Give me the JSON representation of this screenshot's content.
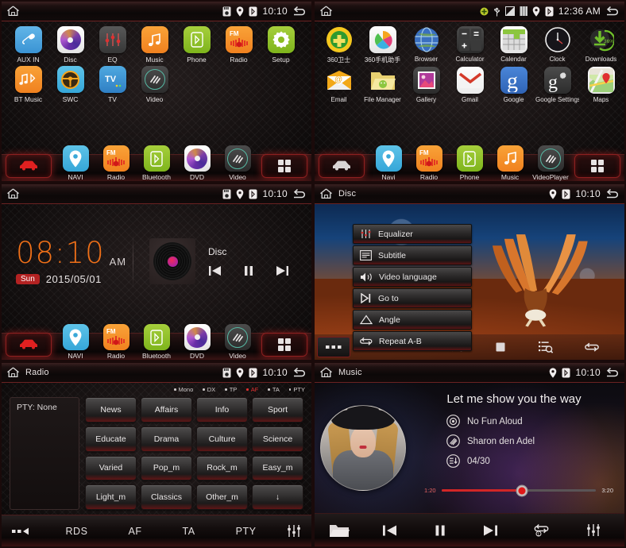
{
  "panels": {
    "home_apps": {
      "status": {
        "title": "",
        "time": "10:10",
        "icons": [
          "sd-card-icon",
          "location-icon",
          "bluetooth-icon"
        ],
        "back": "back-icon"
      },
      "rows": [
        [
          {
            "label": "AUX IN",
            "icon": "aux-plug-icon",
            "style": "g-blue"
          },
          {
            "label": "Disc",
            "icon": "disc-icon",
            "style": "g-white"
          },
          {
            "label": "EQ",
            "icon": "equalizer-icon",
            "style": "g-grey"
          },
          {
            "label": "Music",
            "icon": "music-note-icon",
            "style": "g-orange"
          },
          {
            "label": "Phone",
            "icon": "bluetooth-phone-icon",
            "style": "g-green"
          },
          {
            "label": "Radio",
            "icon": "fm-radio-icon",
            "style": "g-orange"
          },
          {
            "label": "Setup",
            "icon": "gear-icon",
            "style": "g-green"
          }
        ],
        [
          {
            "label": "BT Music",
            "icon": "bt-music-icon",
            "style": "g-orange"
          },
          {
            "label": "SWC",
            "icon": "steering-wheel-icon",
            "style": "g-cyan"
          },
          {
            "label": "TV",
            "icon": "tv-icon",
            "style": "g-tvblue"
          },
          {
            "label": "Video",
            "icon": "video-icon",
            "style": "g-dark"
          }
        ]
      ],
      "dock": {
        "home_button": "car-home-icon",
        "apps_button": "app-drawer-icon",
        "items": [
          {
            "label": "NAVI",
            "icon": "navi-pin-icon",
            "style": "g-cyan"
          },
          {
            "label": "Radio",
            "icon": "fm-radio-icon",
            "style": "g-orange"
          },
          {
            "label": "Bluetooth",
            "icon": "bluetooth-phone-icon",
            "style": "g-green"
          },
          {
            "label": "DVD",
            "icon": "disc-icon",
            "style": "g-white"
          },
          {
            "label": "Video",
            "icon": "video-icon",
            "style": "g-dark"
          }
        ]
      }
    },
    "android_apps": {
      "status": {
        "title": "",
        "time": "12:36 AM",
        "icons": [
          "update-icon",
          "usb-icon",
          "screenshot-icon",
          "sim-icon",
          "location-icon",
          "bluetooth-icon"
        ],
        "back": "back-icon"
      },
      "rows": [
        [
          {
            "label": "360卫士",
            "icon": "360-guard-icon",
            "style": "circ"
          },
          {
            "label": "360手机助手",
            "icon": "360-assistant-icon",
            "style": "g-white"
          },
          {
            "label": "Browser",
            "icon": "browser-globe-icon",
            "style": "circ"
          },
          {
            "label": "Calculator",
            "icon": "calculator-icon",
            "style": "g-dark"
          },
          {
            "label": "Calendar",
            "icon": "calendar-icon",
            "style": "g-white"
          },
          {
            "label": "Clock",
            "icon": "clock-icon",
            "style": "circ"
          },
          {
            "label": "Downloads",
            "icon": "download-icon",
            "style": "circ",
            "badge": "36%"
          }
        ],
        [
          {
            "label": "Email",
            "icon": "email-envelope-icon",
            "style": "none"
          },
          {
            "label": "File Manager",
            "icon": "file-folder-icon",
            "style": "none"
          },
          {
            "label": "Gallery",
            "icon": "gallery-photo-icon",
            "style": "g-dark"
          },
          {
            "label": "Gmail",
            "icon": "gmail-icon",
            "style": "g-gmail"
          },
          {
            "label": "Google",
            "icon": "google-search-icon",
            "style": "g-gblue"
          },
          {
            "label": "Google Settings",
            "icon": "google-settings-icon",
            "style": "g-dark"
          },
          {
            "label": "Maps",
            "icon": "maps-icon",
            "style": "g-white"
          }
        ]
      ],
      "dock": {
        "home_button": "car-home-icon",
        "apps_button": "app-drawer-icon",
        "items": [
          {
            "label": "Navi",
            "icon": "navi-pin-icon",
            "style": "g-cyan"
          },
          {
            "label": "Radio",
            "icon": "fm-radio-icon",
            "style": "g-orange"
          },
          {
            "label": "Phone",
            "icon": "bluetooth-phone-icon",
            "style": "g-green"
          },
          {
            "label": "Music",
            "icon": "music-note-icon",
            "style": "g-orange"
          },
          {
            "label": "VideoPlayer",
            "icon": "video-icon",
            "style": "g-dark"
          }
        ]
      }
    },
    "clock_home": {
      "status": {
        "title": "",
        "time": "10:10",
        "back": "back-icon"
      },
      "time": "08:10",
      "ampm": "AM",
      "day": "Sun",
      "date": "2015/05/01",
      "source_label": "Disc",
      "controls": [
        "prev-track-icon",
        "pause-icon",
        "next-track-icon"
      ],
      "dock": {
        "items": [
          {
            "label": "NAVI",
            "icon": "navi-pin-icon",
            "style": "g-cyan"
          },
          {
            "label": "Radio",
            "icon": "fm-radio-icon",
            "style": "g-orange"
          },
          {
            "label": "Bluetooth",
            "icon": "bluetooth-phone-icon",
            "style": "g-green"
          },
          {
            "label": "DVD",
            "icon": "disc-icon",
            "style": "g-white"
          },
          {
            "label": "Video",
            "icon": "video-icon",
            "style": "g-dark"
          }
        ]
      }
    },
    "disc_player": {
      "status": {
        "title": "Disc",
        "time": "10:10",
        "back": "back-icon"
      },
      "menu": [
        {
          "label": "Equalizer",
          "icon": "equalizer-icon"
        },
        {
          "label": "Subtitle",
          "icon": "subtitle-icon"
        },
        {
          "label": "Video language",
          "icon": "audio-language-icon"
        },
        {
          "label": "Go to",
          "icon": "goto-icon"
        },
        {
          "label": "Angle",
          "icon": "angle-icon"
        },
        {
          "label": "Repeat A-B",
          "icon": "repeat-ab-icon"
        }
      ],
      "controlbar": {
        "more": "more-dots-icon",
        "items": [
          "next-track-icon",
          "stop-icon",
          "playlist-search-icon",
          "repeat-icon"
        ]
      }
    },
    "radio": {
      "status": {
        "title": "Radio",
        "time": "10:10",
        "back": "back-icon"
      },
      "bands": [
        {
          "label": "Mono",
          "active": false
        },
        {
          "label": "DX",
          "active": false
        },
        {
          "label": "TP",
          "active": false
        },
        {
          "label": "AF",
          "active": true
        },
        {
          "label": "TA",
          "active": false
        },
        {
          "label": "PTY",
          "active": false
        }
      ],
      "pty_label": "PTY:  None",
      "pty_buttons": [
        "News",
        "Affairs",
        "Info",
        "Sport",
        "Educate",
        "Drama",
        "Culture",
        "Science",
        "Varied",
        "Pop_m",
        "Rock_m",
        "Easy_m",
        "Light_m",
        "Classics",
        "Other_m",
        "↓"
      ],
      "bottom": {
        "back_icon": "dots-back-icon",
        "tabs": [
          "RDS",
          "AF",
          "TA",
          "PTY"
        ],
        "eq_icon": "equalizer-icon"
      }
    },
    "music": {
      "status": {
        "title": "Music",
        "time": "10:10",
        "back": "back-icon"
      },
      "title": "Let me show you the way",
      "album": "No Fun Aloud",
      "artist": "Sharon den Adel",
      "track_index": "04/30",
      "elapsed": "1:20",
      "duration": "3:20",
      "progress_percent": 40,
      "controlbar": {
        "folder": "folder-icon",
        "items": [
          "prev-track-icon",
          "pause-icon",
          "next-track-icon",
          "repeat-one-icon",
          "equalizer-icon"
        ]
      }
    }
  },
  "colors": {
    "accent_red": "#b32222",
    "accent_orange": "#f07018",
    "active_band": "#e03030",
    "progress": "#d22626"
  }
}
